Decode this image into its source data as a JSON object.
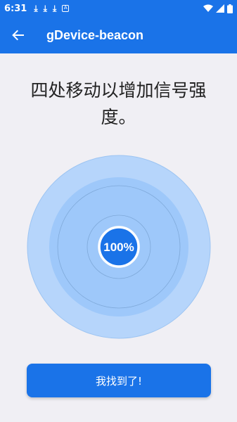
{
  "status": {
    "time": "6:31",
    "download_icons": [
      "download-icon",
      "download-icon",
      "download-icon"
    ],
    "notification_badge": "A",
    "right_icons": [
      "wifi-icon",
      "signal-icon",
      "battery-icon"
    ]
  },
  "app_bar": {
    "title": "gDevice-beacon",
    "back_icon": "arrow-back-icon"
  },
  "instruction": {
    "line1": "四处移动以增加信号强",
    "line2": "度。"
  },
  "signal": {
    "percent_label": "100%",
    "percent": 100
  },
  "actions": {
    "found_label": "我找到了!"
  },
  "colors": {
    "primary": "#1a73e8",
    "background": "#f0eff4",
    "radar_outer": "#b6d5fb",
    "radar_inner": "#9ec8fa",
    "center": "#1a73e8"
  }
}
